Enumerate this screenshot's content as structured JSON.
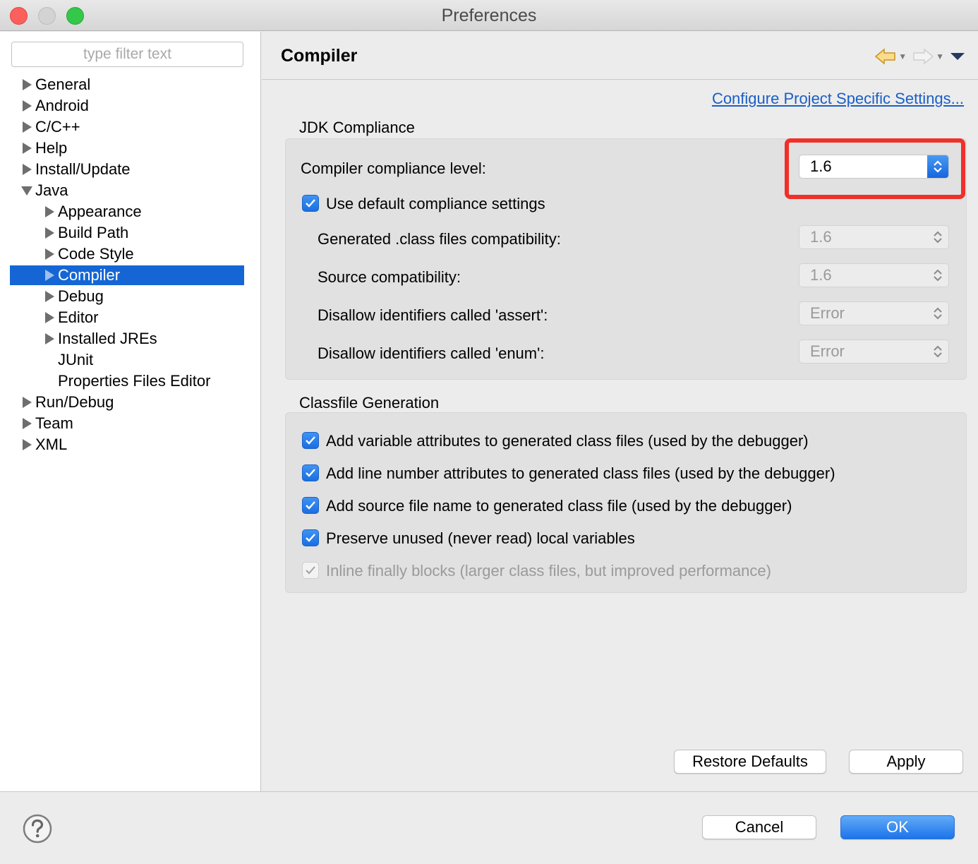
{
  "window": {
    "title": "Preferences"
  },
  "filter": {
    "placeholder": "type filter text"
  },
  "tree": {
    "items": [
      {
        "label": "General",
        "state": "collapsed"
      },
      {
        "label": "Android",
        "state": "collapsed"
      },
      {
        "label": "C/C++",
        "state": "collapsed"
      },
      {
        "label": "Help",
        "state": "collapsed"
      },
      {
        "label": "Install/Update",
        "state": "collapsed"
      },
      {
        "label": "Java",
        "state": "expanded"
      },
      {
        "label": "Appearance",
        "state": "collapsed"
      },
      {
        "label": "Build Path",
        "state": "collapsed"
      },
      {
        "label": "Code Style",
        "state": "collapsed"
      },
      {
        "label": "Compiler",
        "state": "collapsed",
        "selected": true
      },
      {
        "label": "Debug",
        "state": "collapsed"
      },
      {
        "label": "Editor",
        "state": "collapsed"
      },
      {
        "label": "Installed JREs",
        "state": "collapsed"
      },
      {
        "label": "JUnit",
        "state": "leaf"
      },
      {
        "label": "Properties Files Editor",
        "state": "leaf"
      },
      {
        "label": "Run/Debug",
        "state": "collapsed"
      },
      {
        "label": "Team",
        "state": "collapsed"
      },
      {
        "label": "XML",
        "state": "collapsed"
      }
    ]
  },
  "page": {
    "title": "Compiler",
    "nav_icons": [
      "back-arrow-icon",
      "forward-arrow-icon",
      "view-menu-icon"
    ],
    "project_link": "Configure Project Specific Settings..."
  },
  "jdk": {
    "group_label": "JDK Compliance",
    "compliance_label": "Compiler compliance level:",
    "compliance_value": "1.6",
    "use_default_label": "Use default compliance settings",
    "use_default_checked": true,
    "generated_label": "Generated .class files compatibility:",
    "generated_value": "1.6",
    "source_label": "Source compatibility:",
    "source_value": "1.6",
    "assert_label": "Disallow identifiers called 'assert':",
    "assert_value": "Error",
    "enum_label": "Disallow identifiers called 'enum':",
    "enum_value": "Error"
  },
  "classfile": {
    "group_label": "Classfile Generation",
    "options": [
      {
        "label": "Add variable attributes to generated class files (used by the debugger)",
        "checked": true,
        "enabled": true
      },
      {
        "label": "Add line number attributes to generated class files (used by the debugger)",
        "checked": true,
        "enabled": true
      },
      {
        "label": "Add source file name to generated class file (used by the debugger)",
        "checked": true,
        "enabled": true
      },
      {
        "label": "Preserve unused (never read) local variables",
        "checked": true,
        "enabled": true
      },
      {
        "label": "Inline finally blocks (larger class files, but improved performance)",
        "checked": true,
        "enabled": false
      }
    ]
  },
  "buttons": {
    "restore_defaults": "Restore Defaults",
    "apply": "Apply",
    "cancel": "Cancel",
    "ok": "OK"
  },
  "colors": {
    "selection": "#1566d4",
    "link": "#1a5ec7",
    "highlight": "#f0302a",
    "primary_button": "#1b74ea"
  }
}
